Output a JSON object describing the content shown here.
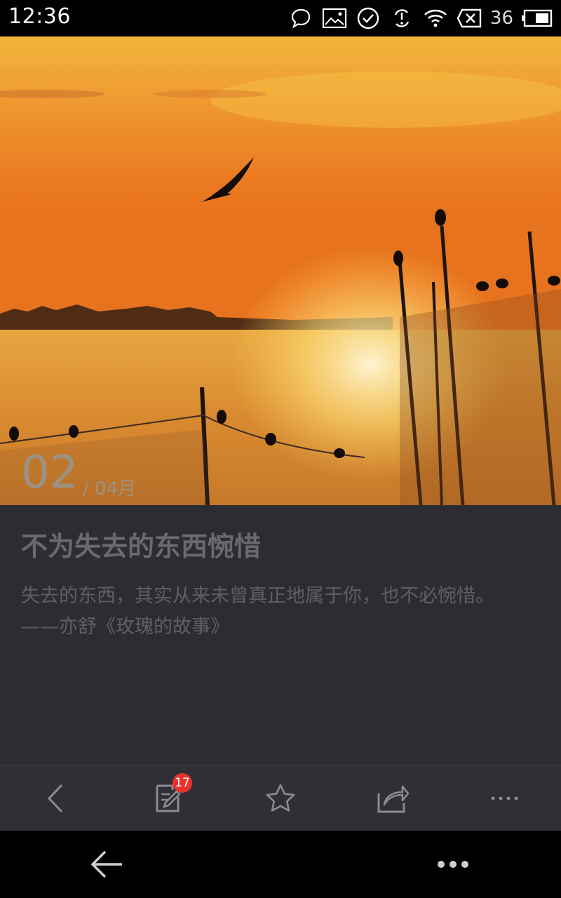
{
  "status_bar": {
    "time": "12:36",
    "battery_level": "36",
    "icons": [
      "chat-bubble-icon",
      "image-icon",
      "check-circle-icon",
      "sync-icon",
      "wifi-icon",
      "no-signal-icon",
      "battery-icon"
    ]
  },
  "hero": {
    "date_day": "02",
    "date_month": "/ 04月"
  },
  "article": {
    "title": "不为失去的东西惋惜",
    "quote": "失去的东西，其实从来未曾真正地属于你，也不必惋惜。——亦舒《玫瑰的故事》"
  },
  "toolbar": {
    "items": [
      "back-icon",
      "note-icon",
      "star-icon",
      "share-icon",
      "more-icon"
    ],
    "note_badge": "17"
  },
  "navbar": {
    "items": [
      "back-arrow-icon",
      "menu-dots-icon"
    ]
  },
  "colors": {
    "content_bg": "#2c2d33",
    "toolbar_bg": "#2f3036",
    "badge": "#e8332b"
  }
}
